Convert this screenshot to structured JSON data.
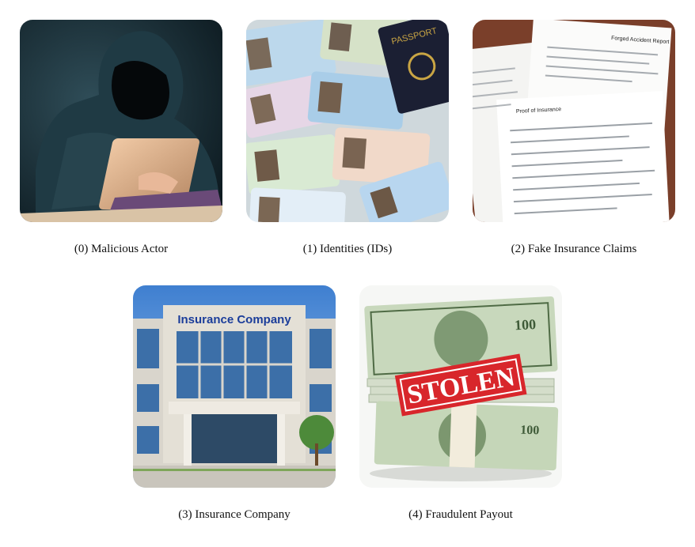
{
  "panels": [
    {
      "caption": "(0) Malicious Actor",
      "image": "hooded-hacker-at-laptop"
    },
    {
      "caption": "(1) Identities (IDs)",
      "image": "stack-of-id-cards-and-passport",
      "passport_text": "PASSPORT"
    },
    {
      "caption": "(2) Fake Insurance Claims",
      "image": "stack-of-claim-forms",
      "doc_headings": [
        "Forged Accident Report",
        "Proof of Insurance"
      ]
    },
    {
      "caption": "(3) Insurance Company",
      "image": "office-building",
      "sign_text": "Insurance Company"
    },
    {
      "caption": "(4) Fraudulent Payout",
      "image": "stack-of-cash-with-stamp",
      "stamp_text": "STOLEN",
      "bill_value": "100"
    }
  ]
}
